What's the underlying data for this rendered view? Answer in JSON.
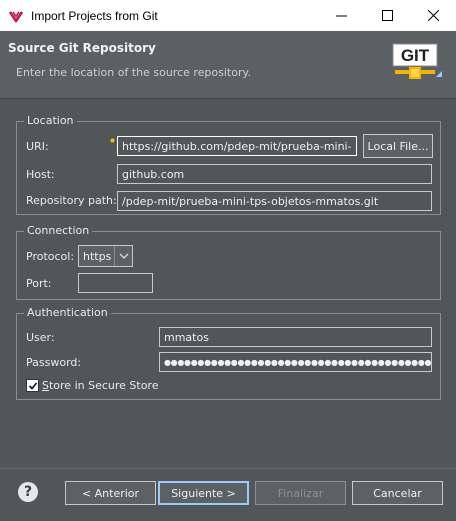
{
  "window": {
    "title": "Import Projects from Git",
    "controls": {
      "minimize": "—",
      "maximize": "☐",
      "close": "✕"
    }
  },
  "banner": {
    "heading": "Source Git Repository",
    "subtitle": "Enter the location of the source repository.",
    "logo_text": "GIT"
  },
  "location": {
    "legend": "Location",
    "uri_label": "URI:",
    "uri_value": "https://github.com/pdep-mit/prueba-mini-",
    "local_file_label": "Local File...",
    "host_label": "Host:",
    "host_value": "github.com",
    "repo_path_label": "Repository path:",
    "repo_path_value": "/pdep-mit/prueba-mini-tps-objetos-mmatos.git"
  },
  "connection": {
    "legend": "Connection",
    "protocol_label": "Protocol:",
    "protocol_value": "https",
    "port_label": "Port:",
    "port_value": ""
  },
  "authentication": {
    "legend": "Authentication",
    "user_label": "User:",
    "user_value": "mmatos",
    "password_label": "Password:",
    "password_value": "●●●●●●●●●●●●●●●●●●●●●●●●●●●●●●●●●●●●●●●●●●●●●●●●",
    "store_label": "Store in Secure Store",
    "store_checked": true
  },
  "footer": {
    "help_label": "?",
    "back_label": "< Anterior",
    "next_label": "Siguiente >",
    "finish_label": "Finalizar",
    "cancel_label": "Cancelar"
  },
  "colors": {
    "background": "#515658",
    "banner": "#5b6063",
    "primary_border": "#9ec9ff",
    "eclipse_icon": "#c2185b"
  }
}
